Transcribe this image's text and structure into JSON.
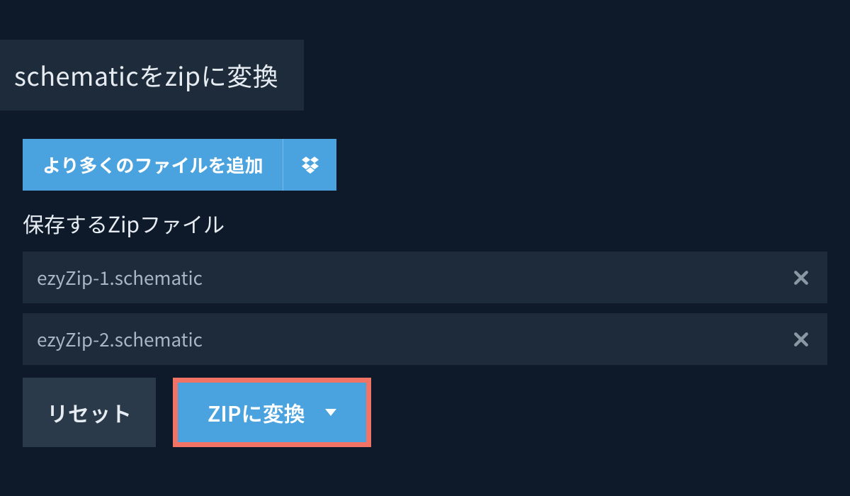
{
  "title": "schematicをzipに変換",
  "add_more": {
    "label": "より多くのファイルを追加",
    "dropbox_icon": "dropbox"
  },
  "section_label": "保存するZipファイル",
  "files": [
    {
      "name": "ezyZip-1.schematic"
    },
    {
      "name": "ezyZip-2.schematic"
    }
  ],
  "actions": {
    "reset": "リセット",
    "convert": "ZIPに変換"
  }
}
